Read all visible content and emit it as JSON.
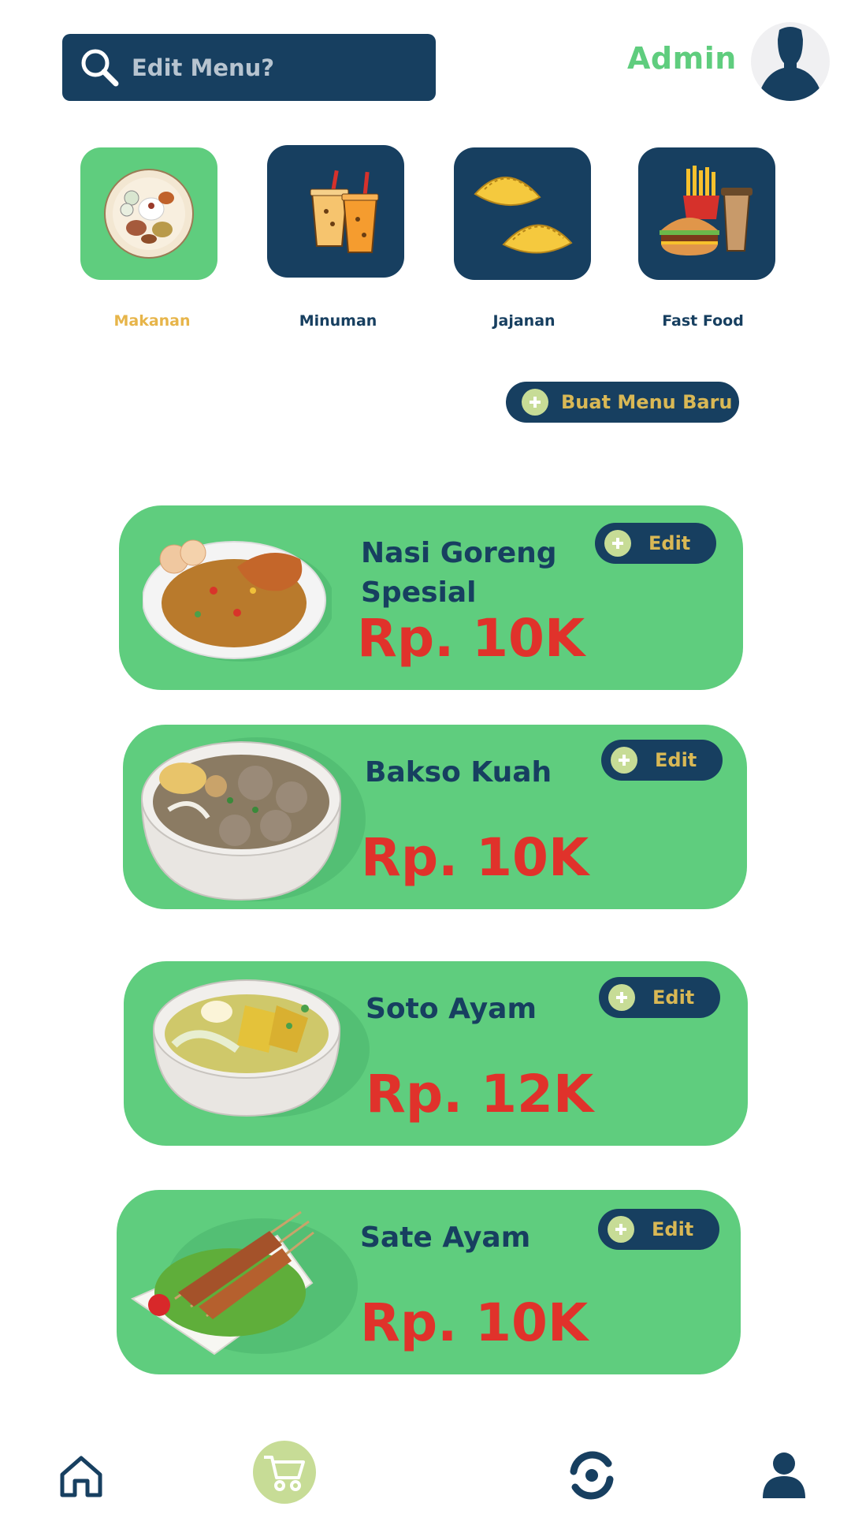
{
  "header": {
    "search_placeholder": "Edit Menu?",
    "user_label": "Admin"
  },
  "categories": [
    {
      "label": "Makanan",
      "icon": "rice-plate-icon",
      "active": true
    },
    {
      "label": "Minuman",
      "icon": "drinks-icon",
      "active": false
    },
    {
      "label": "Jajanan",
      "icon": "pastry-icon",
      "active": false
    },
    {
      "label": "Fast Food",
      "icon": "fast-food-icon",
      "active": false
    }
  ],
  "new_menu_button": {
    "label": "Buat Menu Baru",
    "icon": "plus-icon"
  },
  "menu_items": [
    {
      "name": "Nasi Goreng Spesial",
      "price": "Rp. 10K",
      "edit_label": "Edit",
      "image": "fried-rice-image"
    },
    {
      "name": "Bakso Kuah",
      "price": "Rp. 10K",
      "edit_label": "Edit",
      "image": "meatball-soup-image"
    },
    {
      "name": "Soto Ayam",
      "price": "Rp. 12K",
      "edit_label": "Edit",
      "image": "chicken-soup-image"
    },
    {
      "name": "Sate Ayam",
      "price": "Rp. 10K",
      "edit_label": "Edit",
      "image": "chicken-satay-image"
    }
  ],
  "bottom_nav": [
    {
      "name": "home",
      "icon": "home-icon"
    },
    {
      "name": "cart",
      "icon": "cart-icon"
    },
    {
      "name": "history",
      "icon": "refresh-icon"
    },
    {
      "name": "profile",
      "icon": "user-icon"
    }
  ],
  "colors": {
    "primary_dark": "#173f60",
    "accent_green": "#5fcd7e",
    "price_red": "#e0322b",
    "gold": "#d9b855",
    "active_category_text": "#e7b54a",
    "cart_circle": "#c7dc96"
  }
}
